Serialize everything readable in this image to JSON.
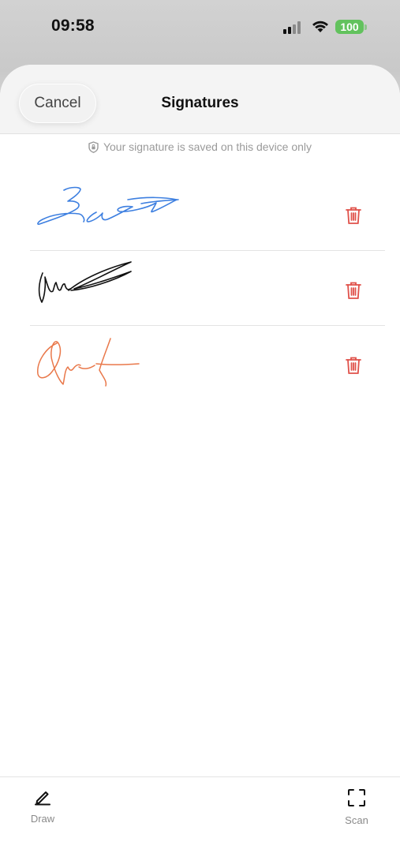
{
  "status_bar": {
    "time": "09:58",
    "battery": "100"
  },
  "header": {
    "cancel_label": "Cancel",
    "title": "Signatures"
  },
  "notice": {
    "text": "Your signature is saved on this device only",
    "icon": "shield-icon"
  },
  "signatures": [
    {
      "color": "#3d7fe0",
      "delete_icon": "trash-icon"
    },
    {
      "color": "#111111",
      "delete_icon": "trash-icon"
    },
    {
      "color": "#e9784a",
      "delete_icon": "trash-icon"
    }
  ],
  "toolbar": {
    "draw_label": "Draw",
    "draw_icon": "pencil-icon",
    "scan_label": "Scan",
    "scan_icon": "scan-frame-icon"
  },
  "colors": {
    "delete_red": "#e0514a",
    "battery_green": "#62c25d"
  }
}
